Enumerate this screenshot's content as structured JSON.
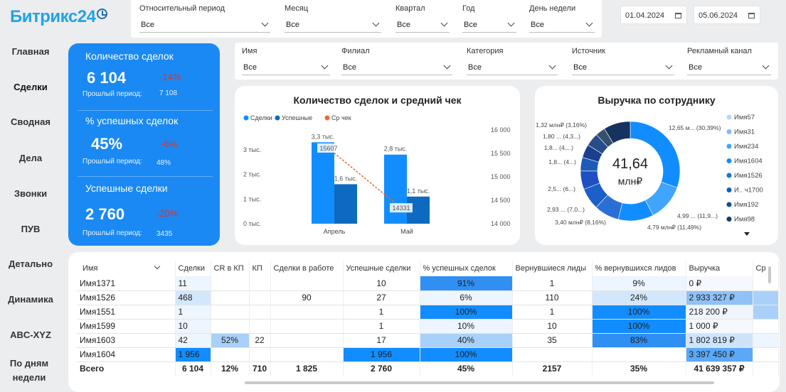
{
  "logo": "Битрикс24",
  "filters1": [
    {
      "label": "Относительный период",
      "value": "Все"
    },
    {
      "label": "Месяц",
      "value": "Все"
    },
    {
      "label": "Квартал",
      "value": "Все"
    },
    {
      "label": "Год",
      "value": "Все"
    },
    {
      "label": "День недели",
      "value": "Все"
    }
  ],
  "date_from": "01.04.2024",
  "date_to": "05.06.2024",
  "filters2": [
    {
      "label": "Имя",
      "value": "Все"
    },
    {
      "label": "Филиал",
      "value": "Все"
    },
    {
      "label": "Категория",
      "value": "Все"
    },
    {
      "label": "Источник",
      "value": "Все"
    },
    {
      "label": "Рекламный канал",
      "value": "Все"
    }
  ],
  "nav": [
    "Главная",
    "Сделки",
    "Сводная",
    "Дела",
    "Звонки",
    "ПУВ",
    "Детально",
    "Динамика",
    "ABC-XYZ",
    "По дням недели"
  ],
  "kpis": [
    {
      "title": "Количество сделок",
      "value": "6 104",
      "delta": "-14%",
      "prev_label": "Прошлый период:",
      "prev_value": "7 108"
    },
    {
      "title": "% успешных сделок",
      "value": "45%",
      "delta": "-6%",
      "prev_label": "Прошлый период:",
      "prev_value": "48%"
    },
    {
      "title": "Успешные сделки",
      "value": "2 760",
      "delta": "-20%",
      "prev_label": "Прошлый период:",
      "prev_value": "3435"
    }
  ],
  "chart_data": [
    {
      "type": "bar",
      "title": "Количество сделок и средний чек",
      "legend": [
        "Сделки",
        "Успешные",
        "Ср чек"
      ],
      "categories": [
        "Апрель",
        "Май"
      ],
      "series": [
        {
          "name": "Сделки",
          "values": [
            3300,
            2800
          ],
          "labels": [
            "3,3 тыс.",
            "2,8 тыс."
          ],
          "color": "#118dff"
        },
        {
          "name": "Успешные",
          "values": [
            1600,
            1100
          ],
          "labels": [
            "1,6 тыс.",
            "1,1 тыс."
          ],
          "color": "#0d6abf"
        },
        {
          "name": "Ср чек",
          "values": [
            15607,
            14331
          ],
          "labels": [
            "15607",
            "14331"
          ],
          "color": "#e66c37"
        }
      ],
      "yticks_left": [
        "0 тыс.",
        "1 тыс.",
        "2 тыс.",
        "3 тыс."
      ],
      "yticks_right": [
        "14 000",
        "14 500",
        "15 000",
        "15 500",
        "16 000"
      ],
      "ylim_left": [
        0,
        3800
      ],
      "ylim_right": [
        14000,
        16000
      ]
    },
    {
      "type": "pie",
      "title": "Выручка по сотруднику",
      "center_value": "41,64",
      "center_unit": "млн₽",
      "slices": [
        {
          "label": "12,65 м... (30,39%)",
          "value": 30.39,
          "color": "#118dff"
        },
        {
          "label": "4,99 ... (11,9...)",
          "value": 11.99,
          "color": "#41a4ff"
        },
        {
          "label": "4,79 млн₽ (11,49%)",
          "value": 11.49,
          "color": "#118dff"
        },
        {
          "label": "3,40 млн₽ (8,16%)",
          "value": 8.16,
          "color": "#2a6fd6"
        },
        {
          "label": "2,93 ... (7,0...)",
          "value": 7.04,
          "color": "#1d5fc9"
        },
        {
          "label": "2,5... (6...)",
          "value": 6.0,
          "color": "#1f4fc2"
        },
        {
          "label": "1,8... (4...)",
          "value": 4.4,
          "color": "#1c5bb8"
        },
        {
          "label": "1,8... (4,...)",
          "value": 4.35,
          "color": "#1a3f8f"
        },
        {
          "label": "1,80 ... (4,3...)",
          "value": 4.32,
          "color": "#264d8a"
        },
        {
          "label": "1,32 млн₽ (3,16%)",
          "value": 3.16,
          "color": "#34506e"
        },
        {
          "label": "",
          "value": 8.7,
          "color": "#16325e"
        }
      ],
      "legend": [
        {
          "name": "Имя57",
          "color": "#b3d7ff"
        },
        {
          "name": "Имя31",
          "color": "#7ebcff"
        },
        {
          "name": "Имя234",
          "color": "#41a4ff"
        },
        {
          "name": "Имя1604",
          "color": "#118dff"
        },
        {
          "name": "Имя1526",
          "color": "#0d78de"
        },
        {
          "name": "И.. ч1700",
          "color": "#0b63bf"
        },
        {
          "name": "Имя192",
          "color": "#0a4f99"
        },
        {
          "name": "Имя98",
          "color": "#123a6b"
        }
      ]
    }
  ],
  "table": {
    "columns": [
      "Имя",
      "Сделки",
      "CR в КП",
      "КП",
      "Сделки в работе",
      "Успешные сделки",
      "% успешных сделок",
      "Вернувшиеся лиды",
      "% вернувшихся лидов",
      "Выручка",
      "Ср"
    ],
    "rows": [
      [
        "Имя1371",
        "11",
        "",
        "",
        "",
        "10",
        "91%",
        "1",
        "9%",
        "0 ₽",
        ""
      ],
      [
        "Имя1526",
        "468",
        "",
        "",
        "90",
        "27",
        "6%",
        "110",
        "24%",
        "2 933 327 ₽",
        ""
      ],
      [
        "Имя1551",
        "1",
        "",
        "",
        "",
        "1",
        "100%",
        "1",
        "100%",
        "218 200 ₽",
        ""
      ],
      [
        "Имя1599",
        "10",
        "",
        "",
        "",
        "1",
        "10%",
        "10",
        "100%",
        "1 000 ₽",
        ""
      ],
      [
        "Имя1603",
        "42",
        "52%",
        "22",
        "",
        "17",
        "40%",
        "35",
        "83%",
        "1 802 819 ₽",
        ""
      ],
      [
        "Имя1604",
        "1 956",
        "",
        "",
        "",
        "1 956",
        "100%",
        "",
        "",
        "3 397 450 ₽",
        ""
      ]
    ],
    "total": [
      "Всего",
      "6 104",
      "12%",
      "710",
      "1 825",
      "2 760",
      "45%",
      "2157",
      "35%",
      "41 639 357 ₽",
      ""
    ]
  }
}
